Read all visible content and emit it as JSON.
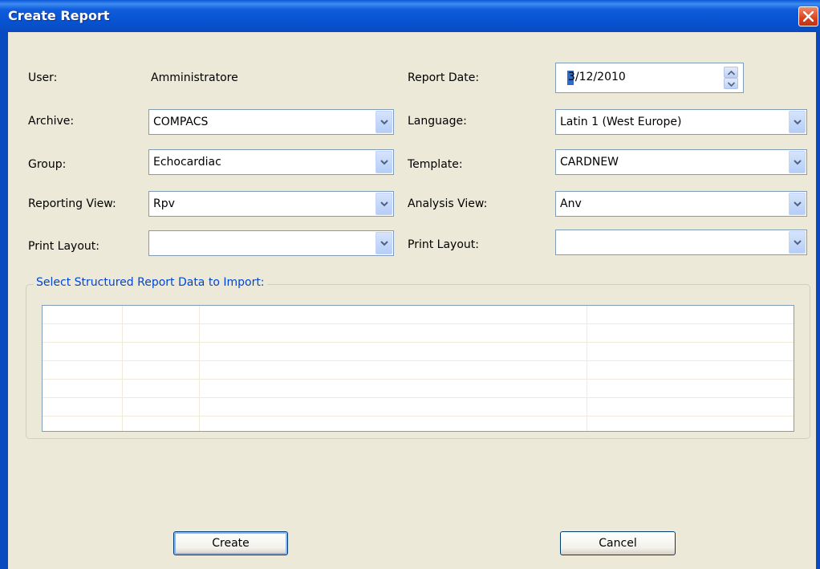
{
  "window": {
    "title": "Create Report"
  },
  "form": {
    "user_label": "User:",
    "user_value": "Amministratore",
    "report_date_label": "Report Date:",
    "report_date_value": "3/12/2010",
    "archive_label": "Archive:",
    "archive_value": "COMPACS",
    "language_label": "Language:",
    "language_value": "Latin 1 (West Europe)",
    "group_label": "Group:",
    "group_value": "Echocardiac",
    "template_label": "Template:",
    "template_value": "CARDNEW",
    "reporting_view_label": "Reporting View:",
    "reporting_view_value": "Rpv",
    "analysis_view_label": "Analysis View:",
    "analysis_view_value": "Anv",
    "print_layout_left_label": "Print Layout:",
    "print_layout_left_value": "",
    "print_layout_right_label": "Print Layout:",
    "print_layout_right_value": ""
  },
  "structured_report": {
    "legend": "Select Structured Report Data to Import:",
    "rows": 7,
    "columns": 4
  },
  "buttons": {
    "create": "Create",
    "cancel": "Cancel"
  },
  "icons": {
    "close": "close-icon",
    "dropdown": "chevron-down-icon",
    "spin_up": "spin-up-icon",
    "spin_down": "spin-down-icon"
  },
  "colors": {
    "titlebar": "#0A58D8",
    "background": "#ECE9D8",
    "legend_text": "#0046D5",
    "close_button": "#D8431C",
    "selection": "#316AC5"
  }
}
